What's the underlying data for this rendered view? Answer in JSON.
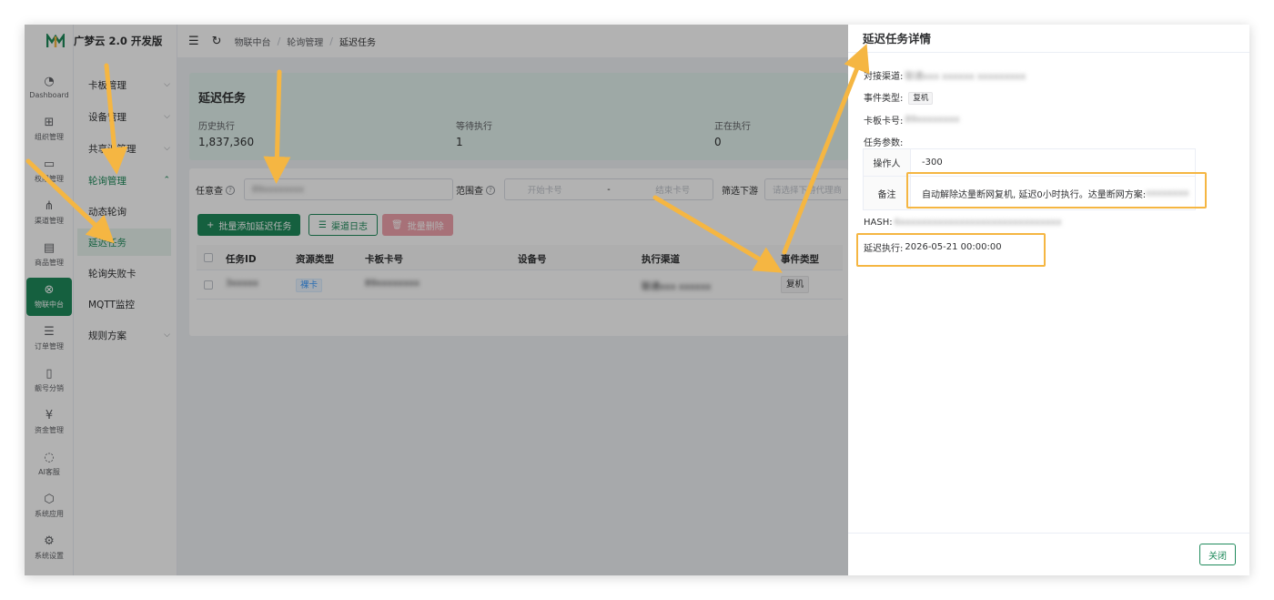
{
  "app": {
    "brand": "广梦云 2.0 开发版"
  },
  "rail": [
    {
      "label": "Dashboard",
      "icon": "dashboard-icon",
      "glyph": "◔"
    },
    {
      "label": "组织管理",
      "icon": "org-icon",
      "glyph": "⊞"
    },
    {
      "label": "权限管理",
      "icon": "permission-icon",
      "glyph": "▭"
    },
    {
      "label": "渠道管理",
      "icon": "channel-icon",
      "glyph": "⋔"
    },
    {
      "label": "商品管理",
      "icon": "product-icon",
      "glyph": "▤"
    },
    {
      "label": "物联中台",
      "icon": "iot-icon",
      "glyph": "⊗"
    },
    {
      "label": "订单管理",
      "icon": "order-icon",
      "glyph": "☰"
    },
    {
      "label": "靓号分销",
      "icon": "number-icon",
      "glyph": "▯"
    },
    {
      "label": "资金管理",
      "icon": "funds-icon",
      "glyph": "¥"
    },
    {
      "label": "AI客服",
      "icon": "ai-service-icon",
      "glyph": "◌"
    },
    {
      "label": "系统应用",
      "icon": "apps-icon",
      "glyph": "⬡"
    },
    {
      "label": "系统设置",
      "icon": "settings-icon",
      "glyph": "⚙"
    }
  ],
  "sidebar": {
    "items": [
      {
        "label": "卡板管理"
      },
      {
        "label": "设备管理"
      },
      {
        "label": "共享池管理"
      },
      {
        "label": "轮询管理"
      },
      {
        "label": "规则方案"
      }
    ],
    "sub": [
      "动态轮询",
      "延迟任务",
      "轮询失败卡",
      "MQTT监控"
    ]
  },
  "breadcrumb": [
    "物联中台",
    "轮询管理",
    "延迟任务"
  ],
  "stats": {
    "title": "延迟任务",
    "history_label": "历史执行",
    "history_value": "1,837,360",
    "waiting_label": "等待执行",
    "waiting_value": "1",
    "running_label": "正在执行",
    "running_value": "0"
  },
  "filters": {
    "any_label": "任意查",
    "any_value": "89xxxxxxxx",
    "range_label": "范围查",
    "start_placeholder": "开始卡号",
    "dash": "-",
    "end_placeholder": "结束卡号",
    "downstream_label": "筛选下游",
    "downstream_placeholder": "请选择下游代理商"
  },
  "actions": {
    "add": "批量添加延迟任务",
    "log": "渠道日志",
    "delete": "批量删除"
  },
  "table": {
    "headers": [
      "任务ID",
      "资源类型",
      "卡板卡号",
      "设备号",
      "执行渠道",
      "事件类型"
    ],
    "row": {
      "id": "3xxxxx",
      "type": "裸卡",
      "card": "89xxxxxxxx",
      "device": "",
      "channel": "联通xxx xxxxxx",
      "event": "复机"
    }
  },
  "drawer": {
    "title": "延迟任务详情",
    "channel_label": "对接渠道:",
    "channel_value": "联通xxx xxxxxx xxxxxxxxx",
    "event_label": "事件类型:",
    "event_value": "复机",
    "card_label": "卡板卡号:",
    "card_value": "89xxxxxxxx",
    "params_label": "任务参数:",
    "operator_key": "操作人",
    "operator_value": "-300",
    "remark_key": "备注",
    "remark_value": "自动解除达量断网复机, 延迟0小时执行。达量断网方案:",
    "remark_hidden": "xxxxxxxx",
    "hash_label": "HASH:",
    "hash_value": "6xxxxxxxxxxxxxxxxxxxxxxxxxxxxxx",
    "delay_label": "延迟执行:",
    "delay_value": "2026-05-21 00:00:00",
    "close": "关闭"
  },
  "colors": {
    "accent": "#1f8a5b",
    "highlight": "#f5b642",
    "danger_light": "#f0a3ac"
  }
}
